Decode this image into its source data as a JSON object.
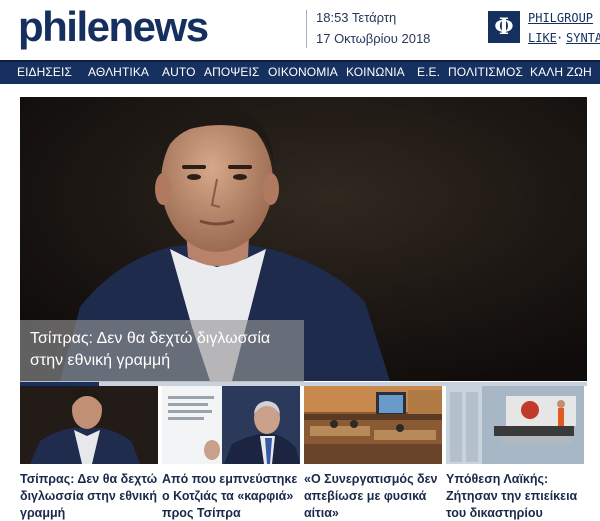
{
  "header": {
    "logo": "philenews",
    "time": "18:53 Τετάρτη",
    "date": "17 Οκτωβρίου 2018",
    "badge_glyph": "Φ",
    "philgroup": "PHILGROUP",
    "like": "LIKE",
    "separator": "·",
    "synta": "SYNTA"
  },
  "nav": {
    "items": [
      {
        "label": "ΕΙΔΗΣΕΙΣ"
      },
      {
        "label": "ΑΘΛΗΤΙΚΑ"
      },
      {
        "label": "AUTO"
      },
      {
        "label": "ΑΠΟΨΕΙΣ"
      },
      {
        "label": "ΟΙΚΟΝΟΜΙΑ"
      },
      {
        "label": "ΚΟΙΝΩΝΙΑ"
      },
      {
        "label": "Ε.Ε."
      },
      {
        "label": "ΠΟΛΙΤΙΣΜΟΣ"
      },
      {
        "label": "ΚΑΛΗ ΖΩΗ"
      }
    ]
  },
  "hero": {
    "caption": "Τσίπρας: Δεν θα δεχτώ διγλωσσία στην εθνική γραμμή",
    "slider_progress": 0.14
  },
  "thumbs": [
    {
      "title": "Τσίπρας: Δεν θα δεχτώ διγλωσσία στην εθνική γραμμή"
    },
    {
      "title": "Από που εμπνεύστηκε ο Κοτζιάς τα «καρφιά» προς Τσίπρα"
    },
    {
      "title": "«Ο Συνεργατισμός δεν απεβίωσε με φυσικά αίτια»"
    },
    {
      "title": "Υπόθεση Λαϊκής: Ζήτησαν την επιείκεια του δικαστηρίου"
    }
  ],
  "colors": {
    "brand_navy": "#16305f",
    "hero_bg": "#1b1613"
  }
}
